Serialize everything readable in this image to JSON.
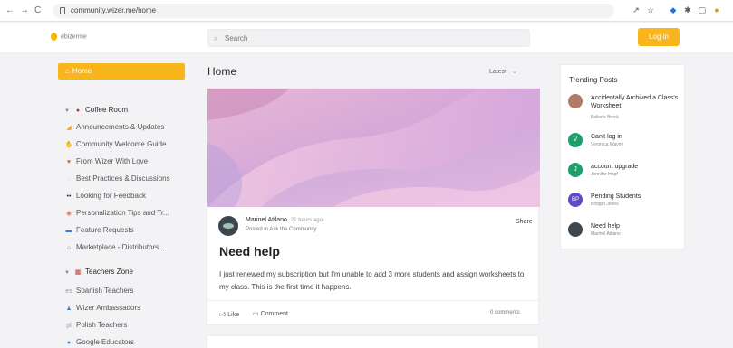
{
  "browser": {
    "url": "community.wizer.me/home",
    "nav_glyphs": [
      "←",
      "→",
      "C"
    ]
  },
  "header": {
    "logo_text": "ebizerme",
    "search_placeholder": "Search",
    "login_label": "Log in"
  },
  "sidebar": {
    "home_label": "Home",
    "sections": [
      {
        "title": "Coffee Room",
        "items": [
          {
            "label": "Announcements & Updates",
            "icon": "megaphone-icon",
            "color": "#f5a623"
          },
          {
            "label": "Community Welcome Guide",
            "icon": "hand-icon",
            "color": "#f5a623"
          },
          {
            "label": "From Wizer With Love",
            "icon": "heart-icon",
            "color": "#e05c3a"
          },
          {
            "label": "Best Practices & Discussions",
            "icon": "circle-icon",
            "color": "#cccccc"
          },
          {
            "label": "Looking for Feedback",
            "icon": "eyes-icon",
            "color": "#333333"
          },
          {
            "label": "Personalization Tips and Tr...",
            "icon": "palette-icon",
            "color": "#e07a5f"
          },
          {
            "label": "Feature Requests",
            "icon": "list-icon",
            "color": "#3a7bd5"
          },
          {
            "label": "Marketplace - Distributors...",
            "icon": "bag-icon",
            "color": "#888888"
          }
        ]
      },
      {
        "title": "Teachers Zone",
        "items": [
          {
            "label": "Spanish Teachers",
            "icon": "flag-icon",
            "color": "#999999"
          },
          {
            "label": "Wizer Ambassadors",
            "icon": "person-icon",
            "color": "#3a7bd5"
          },
          {
            "label": "Polish Teachers",
            "icon": "flag-icon",
            "color": "#999999"
          },
          {
            "label": "Google Educators",
            "icon": "circle-icon",
            "color": "#3a7bd5"
          }
        ]
      }
    ]
  },
  "main": {
    "title": "Home",
    "sort_label": "Latest",
    "post": {
      "author": "Marinel Atilano",
      "time": "21 hours ago",
      "posted_in": "Posted in Ask the Community",
      "share_label": "Share",
      "title": "Need help",
      "body": "I just renewed my subscription but I'm unable to add 3 more students and assign worksheets to my class. This is the first time it happens.",
      "like_label": "Like",
      "comment_label": "Comment",
      "comments_count": "0 comments"
    }
  },
  "trending": {
    "title": "Trending Posts",
    "items": [
      {
        "title": "Accidentally Archived a Class's Worksheet",
        "author": "Belinda Brock",
        "avatar": "",
        "color": "#b07a68"
      },
      {
        "title": "Can't log in",
        "author": "Veronica Wayne",
        "avatar": "V",
        "color": "#1e9e6a"
      },
      {
        "title": "account upgrade",
        "author": "Jennifer Hopf",
        "avatar": "J",
        "color": "#1e9e6a"
      },
      {
        "title": "Pending Students",
        "author": "Bridget Jones",
        "avatar": "BP",
        "color": "#5b4bc4"
      },
      {
        "title": "Need help",
        "author": "Marinel Atilano",
        "avatar": "",
        "color": "#3e4750"
      }
    ]
  }
}
